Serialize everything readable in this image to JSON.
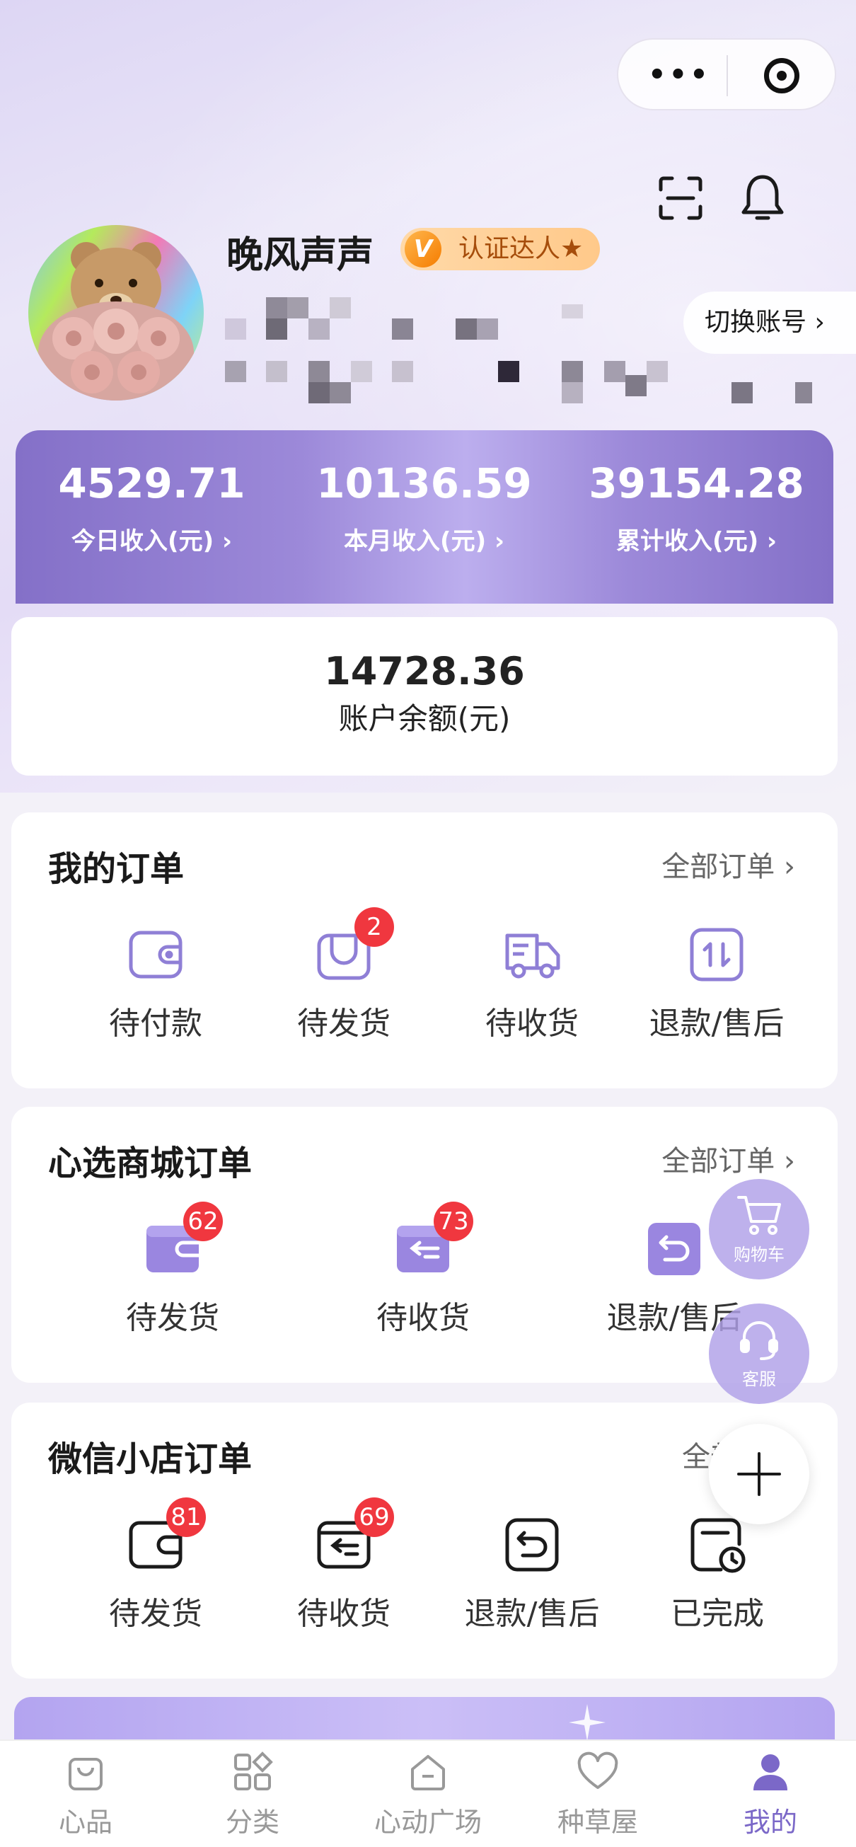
{
  "header": {
    "more_icon": "more-dots-icon",
    "close_icon": "mini-program-close-icon",
    "scan_icon": "scan-icon",
    "bell_icon": "bell-icon"
  },
  "profile": {
    "name": "晚风声声",
    "badge": "认证达人★",
    "badge_letter": "V",
    "switch_label": "切换账号 ›"
  },
  "income": [
    {
      "value": "4529.71",
      "label": "今日收入(元) ›"
    },
    {
      "value": "10136.59",
      "label": "本月收入(元) ›"
    },
    {
      "value": "39154.28",
      "label": "累计收入(元) ›"
    }
  ],
  "balance": {
    "value": "14728.36",
    "label": "账户余额(元)"
  },
  "my_orders": {
    "title": "我的订单",
    "link": "全部订单 ›",
    "items": [
      {
        "label": "待付款",
        "icon": "wallet-icon",
        "badge": ""
      },
      {
        "label": "待发货",
        "icon": "package-icon",
        "badge": "2"
      },
      {
        "label": "待收货",
        "icon": "truck-icon",
        "badge": ""
      },
      {
        "label": "退款/售后",
        "icon": "refund-icon",
        "badge": ""
      }
    ]
  },
  "mall_orders": {
    "title": "心选商城订单",
    "link": "全部订单 ›",
    "items": [
      {
        "label": "待发货",
        "icon": "wallet-icon",
        "badge": "62"
      },
      {
        "label": "待收货",
        "icon": "receive-icon",
        "badge": "73"
      },
      {
        "label": "退款/售后",
        "icon": "return-icon",
        "badge": ""
      }
    ]
  },
  "wechat_orders": {
    "title": "微信小店订单",
    "link": "全部订单",
    "items": [
      {
        "label": "待发货",
        "icon": "wallet-icon",
        "badge": "81"
      },
      {
        "label": "待收货",
        "icon": "receive-icon",
        "badge": "69"
      },
      {
        "label": "退款/售后",
        "icon": "return-icon",
        "badge": ""
      },
      {
        "label": "已完成",
        "icon": "completed-clock-icon",
        "badge": ""
      }
    ]
  },
  "fabs": {
    "cart": "购物车",
    "service": "客服",
    "add_icon": "plus-icon"
  },
  "tabs": [
    {
      "label": "心品",
      "icon": "bag-icon"
    },
    {
      "label": "分类",
      "icon": "category-icon"
    },
    {
      "label": "心动广场",
      "icon": "plaza-icon"
    },
    {
      "label": "种草屋",
      "icon": "heart-icon"
    },
    {
      "label": "我的",
      "icon": "user-icon",
      "active": true
    }
  ],
  "colors": {
    "accent": "#7b68c8",
    "badge_red": "#f0373f",
    "income_bg": "#8470c8",
    "icon_purple": "#8f7fd6"
  }
}
